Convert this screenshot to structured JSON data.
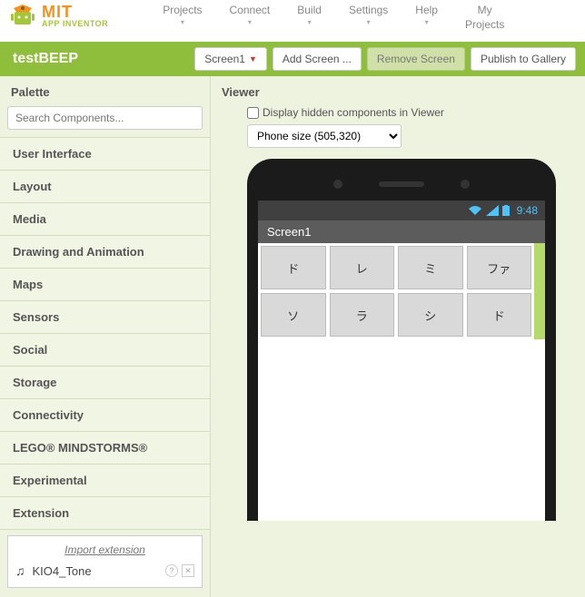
{
  "brand": {
    "mit": "MIT",
    "sub": "APP INVENTOR"
  },
  "menu": {
    "projects": "Projects",
    "connect": "Connect",
    "build": "Build",
    "settings": "Settings",
    "help": "Help",
    "myprojects": "My\nProjects"
  },
  "project": {
    "name": "testBEEP",
    "screen_selector": "Screen1",
    "add_screen": "Add Screen ...",
    "remove_screen": "Remove Screen",
    "publish": "Publish to Gallery"
  },
  "palette": {
    "title": "Palette",
    "search_placeholder": "Search Components...",
    "categories": [
      "User Interface",
      "Layout",
      "Media",
      "Drawing and Animation",
      "Maps",
      "Sensors",
      "Social",
      "Storage",
      "Connectivity",
      "LEGO® MINDSTORMS®",
      "Experimental",
      "Extension"
    ],
    "import_extension": "Import extension",
    "extension_item": "KIO4_Tone"
  },
  "viewer": {
    "title": "Viewer",
    "display_hidden_label": "Display hidden components in Viewer",
    "phone_size": "Phone size (505,320)",
    "status_time": "9:48",
    "app_title": "Screen1",
    "buttons": [
      "ド",
      "レ",
      "ミ",
      "ファ",
      "ソ",
      "ラ",
      "シ",
      "ド"
    ]
  }
}
